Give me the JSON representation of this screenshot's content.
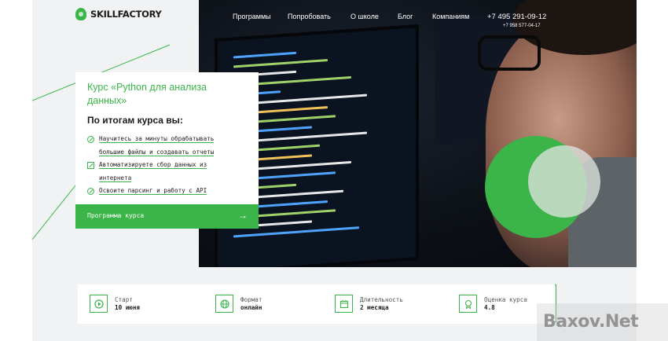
{
  "brand": {
    "name": "SKILLFACTORY"
  },
  "nav": {
    "items": [
      "Программы",
      "Попробовать",
      "О школе",
      "Блог",
      "Компаниям"
    ]
  },
  "contacts": {
    "phone_main": "+7 495 291-09-12",
    "phone_secondary": "+7 958 577-04-17"
  },
  "course_card": {
    "title": "Курс «Python для анализа данных»",
    "subtitle": "По итогам курса вы:",
    "features": [
      {
        "icon": "check-circle-icon",
        "lines": [
          "Научитесь за минуты обрабатывать",
          "большие файлы и создавать отчеты"
        ]
      },
      {
        "icon": "check-square-icon",
        "lines": [
          "Автоматизируете сбор данных из",
          "интернета"
        ]
      },
      {
        "icon": "check-circle-icon",
        "lines": [
          "Освоите парсинг и работу с API"
        ]
      }
    ],
    "cta_label": "Программа курса",
    "cta_arrow": "→"
  },
  "info": [
    {
      "icon": "play-icon",
      "label": "Старт",
      "value": "10 июня"
    },
    {
      "icon": "globe-icon",
      "label": "Формат",
      "value": "онлайн"
    },
    {
      "icon": "calendar-icon",
      "label": "Длительность",
      "value": "2 месяца"
    },
    {
      "icon": "medal-icon",
      "label": "Оценка курса",
      "value": "4.8"
    }
  ],
  "watermark": {
    "text": "Baxov.Net"
  },
  "colors": {
    "accent": "#3bb54a",
    "background": "#f0f2f4",
    "dark": "#1b1b1b"
  }
}
